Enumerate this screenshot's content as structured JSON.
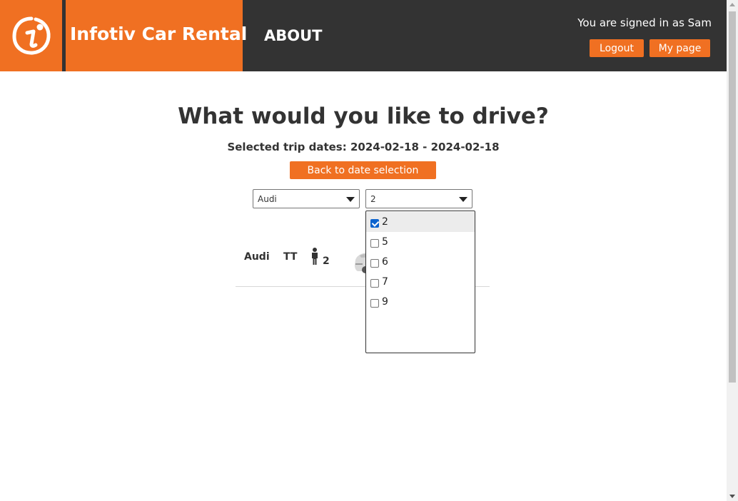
{
  "header": {
    "brand_title": "Infotiv Car Rental",
    "about_label": "ABOUT",
    "signed_in_text": "You are signed in as Sam",
    "logout_label": "Logout",
    "mypage_label": "My page",
    "logo_icon": "infotiv-logo-icon"
  },
  "main": {
    "title": "What would you like to drive?",
    "trip_dates": "Selected trip dates: 2024-02-18 - 2024-02-18",
    "back_label": "Back to date selection"
  },
  "filters": {
    "make_selected": "Audi",
    "seats_selected": "2",
    "seats_options": [
      {
        "label": "2",
        "checked": true
      },
      {
        "label": "5",
        "checked": false
      },
      {
        "label": "6",
        "checked": false
      },
      {
        "label": "7",
        "checked": false
      },
      {
        "label": "9",
        "checked": false
      }
    ]
  },
  "cars": [
    {
      "make": "Audi",
      "model": "TT",
      "seats": "2",
      "icon": "person-icon"
    }
  ],
  "colors": {
    "brand_orange": "#f07022",
    "header_dark": "#333333",
    "checkbox_blue": "#0b63ce"
  }
}
